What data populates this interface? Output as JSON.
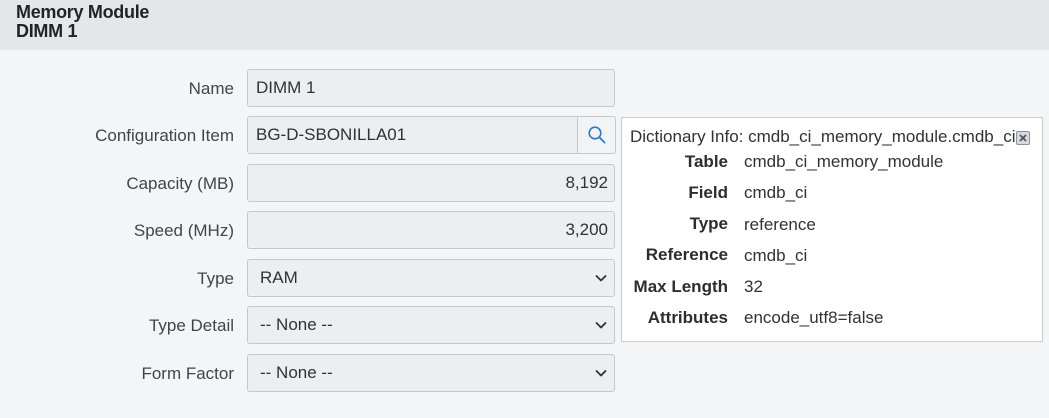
{
  "header": {
    "title": "Memory Module",
    "subtitle": "DIMM 1"
  },
  "form": {
    "name": {
      "label": "Name",
      "value": "DIMM 1"
    },
    "configuration_item": {
      "label": "Configuration Item",
      "value": "BG-D-SBONILLA01",
      "lookup_icon": "search-icon"
    },
    "capacity": {
      "label": "Capacity (MB)",
      "value": "8,192"
    },
    "speed": {
      "label": "Speed (MHz)",
      "value": "3,200"
    },
    "type": {
      "label": "Type",
      "value": "RAM"
    },
    "type_detail": {
      "label": "Type Detail",
      "value": "-- None --"
    },
    "form_factor": {
      "label": "Form Factor",
      "value": "-- None --"
    }
  },
  "dictionary_info": {
    "title": "Dictionary Info: cmdb_ci_memory_module.cmdb_ci",
    "close_icon": "close-icon",
    "rows": [
      {
        "key": "Table",
        "value": "cmdb_ci_memory_module"
      },
      {
        "key": "Field",
        "value": "cmdb_ci"
      },
      {
        "key": "Type",
        "value": "reference"
      },
      {
        "key": "Reference",
        "value": "cmdb_ci"
      },
      {
        "key": "Max Length",
        "value": "32"
      },
      {
        "key": "Attributes",
        "value": "encode_utf8=false"
      }
    ]
  }
}
